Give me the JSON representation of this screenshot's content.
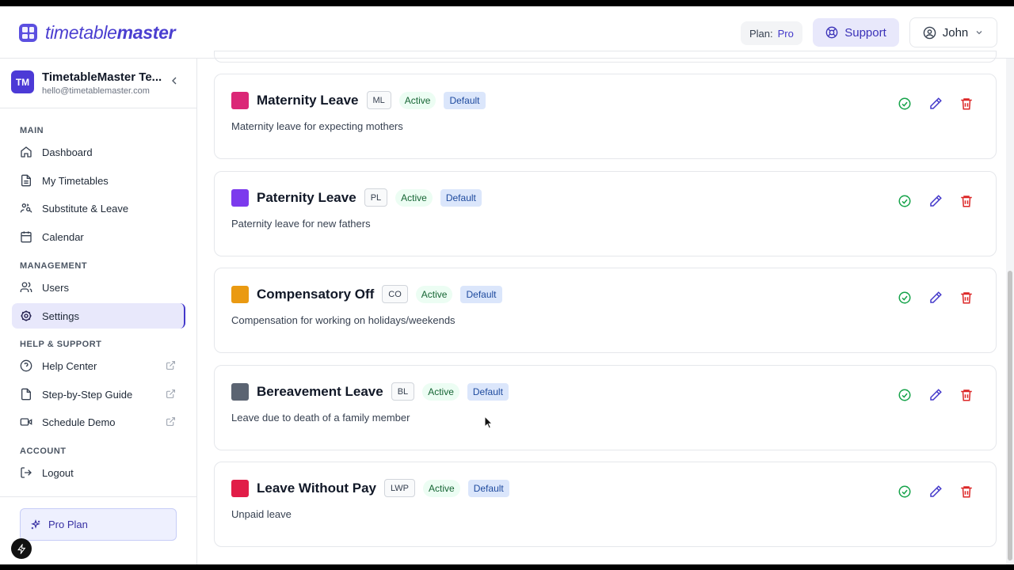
{
  "app": {
    "name_light": "timetable",
    "name_bold": "master"
  },
  "header": {
    "plan_label": "Plan:",
    "plan_value": "Pro",
    "support_label": "Support",
    "user_name": "John"
  },
  "sidebar": {
    "team_initials": "TM",
    "team_name": "TimetableMaster Te...",
    "team_email": "hello@timetablemaster.com",
    "sections": {
      "main": "MAIN",
      "management": "MANAGEMENT",
      "help": "HELP & SUPPORT",
      "account": "ACCOUNT"
    },
    "items": {
      "dashboard": "Dashboard",
      "my_timetables": "My Timetables",
      "substitute_leave": "Substitute & Leave",
      "calendar": "Calendar",
      "users": "Users",
      "settings": "Settings",
      "help_center": "Help Center",
      "guide": "Step-by-Step Guide",
      "demo": "Schedule Demo",
      "logout": "Logout"
    },
    "pro_plan": "Pro Plan"
  },
  "leave_types": [
    {
      "name": "Maternity Leave",
      "code": "ML",
      "status": "Active",
      "tag": "Default",
      "description": "Maternity leave for expecting mothers",
      "color": "#db2777"
    },
    {
      "name": "Paternity Leave",
      "code": "PL",
      "status": "Active",
      "tag": "Default",
      "description": "Paternity leave for new fathers",
      "color": "#7c3aed"
    },
    {
      "name": "Compensatory Off",
      "code": "CO",
      "status": "Active",
      "tag": "Default",
      "description": "Compensation for working on holidays/weekends",
      "color": "#ea9a12"
    },
    {
      "name": "Bereavement Leave",
      "code": "BL",
      "status": "Active",
      "tag": "Default",
      "description": "Leave due to death of a family member",
      "color": "#5b6472"
    },
    {
      "name": "Leave Without Pay",
      "code": "LWP",
      "status": "Active",
      "tag": "Default",
      "description": "Unpaid leave",
      "color": "#e11d48"
    }
  ],
  "colors": {
    "accent": "#4338ca",
    "success": "#16a34a",
    "danger": "#dc2626"
  }
}
